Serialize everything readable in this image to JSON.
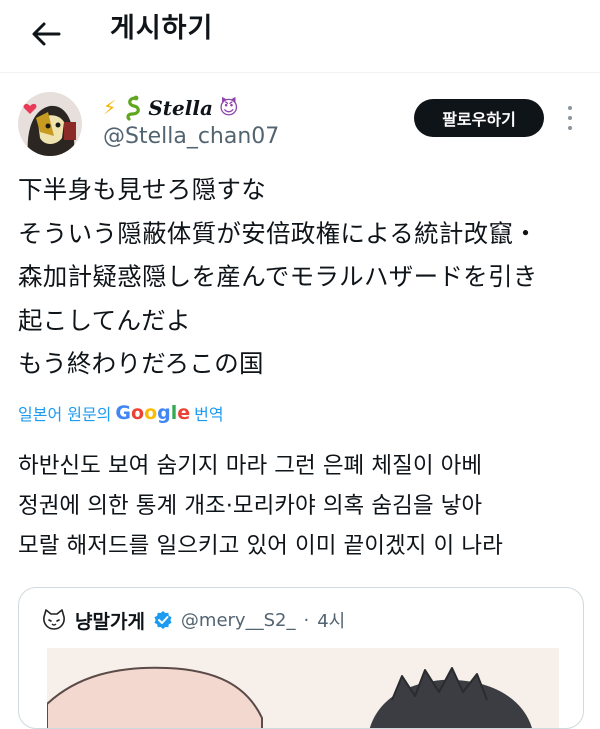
{
  "header": {
    "title": "게시하기"
  },
  "author": {
    "display_name": "Stella",
    "handle": "@Stella_chan07",
    "emoji_lightning": "⚡",
    "emoji_devil": "😈"
  },
  "follow_label": "팔로우하기",
  "tweet": {
    "original_lines": [
      "下半身も見せろ隠すな",
      "そういう隠蔽体質が安倍政権による統計改竄・",
      "森加計疑惑隠しを産んでモラルハザードを引き",
      "起こしてんだよ",
      "もう終わりだろこの国"
    ],
    "translation_prefix": "일본어 원문의",
    "translation_brand": "Google",
    "translation_suffix": "번역",
    "translated_lines": [
      "하반신도 보여 숨기지 마라 그런 은폐 체질이 아베",
      "정권에 의한 통계 개조·모리카야 의혹 숨김을 낳아",
      "모랄 해저드를 일으키고 있어 이미 끝이겠지 이 나라"
    ]
  },
  "quoted_tweet": {
    "name": "냥말가게",
    "handle": "@mery__S2_",
    "separator": "·",
    "time": "4시"
  },
  "icons": {
    "back": "arrow-left-icon",
    "more": "more-vertical-icon",
    "verified": "verified-badge-icon",
    "cat": "cat-face-icon"
  },
  "colors": {
    "link": "#1d9bf0",
    "verified": "#1d9bf0",
    "follow_bg": "#0f1419",
    "muted": "#536471",
    "border": "#cfd9de"
  }
}
